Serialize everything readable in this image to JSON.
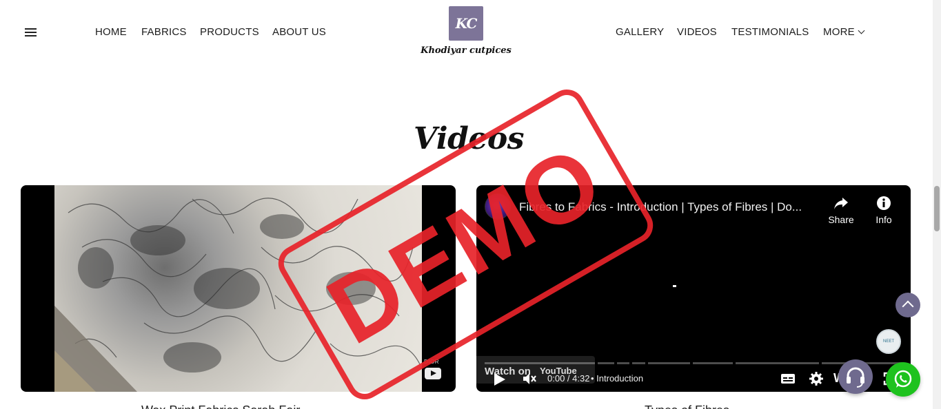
{
  "header": {
    "nav_left": [
      "HOME",
      "FABRICS",
      "PRODUCTS",
      "ABOUT US"
    ],
    "nav_right": [
      "GALLERY",
      "VIDEOS",
      "TESTIMONIALS",
      "MORE"
    ],
    "logo_initials": "KC",
    "logo_text": "Khodiyar cutpices"
  },
  "section": {
    "title": "Videos"
  },
  "videos": [
    {
      "caption": "Wax Print Fabrics Sarah Fair...",
      "badge_label": "DIOR"
    },
    {
      "caption": "Types of Fibres",
      "title": "Fibres to Fabrics - Introduction | Types of Fibres | Do...",
      "share_label": "Share",
      "info_label": "Info",
      "watch_on": "Watch on",
      "youtube_label": "YouTube",
      "time": "0:00 / 4:32",
      "chapter": "• Introduction",
      "watch_letter": "W",
      "corner_badge": "NEET"
    }
  ],
  "stamp": {
    "text": "DEMO"
  },
  "colors": {
    "accent": "#6f6a8e",
    "logo_bg": "#7d7498",
    "stamp": "#e8232a",
    "whatsapp": "#1ec21e"
  },
  "icons": [
    "hamburger-menu-icon",
    "chevron-down-icon",
    "share-icon",
    "info-icon",
    "play-icon",
    "mute-icon",
    "cc-icon",
    "settings-icon",
    "fullscreen-icon",
    "arrow-up-icon",
    "headset-icon",
    "whatsapp-icon"
  ]
}
